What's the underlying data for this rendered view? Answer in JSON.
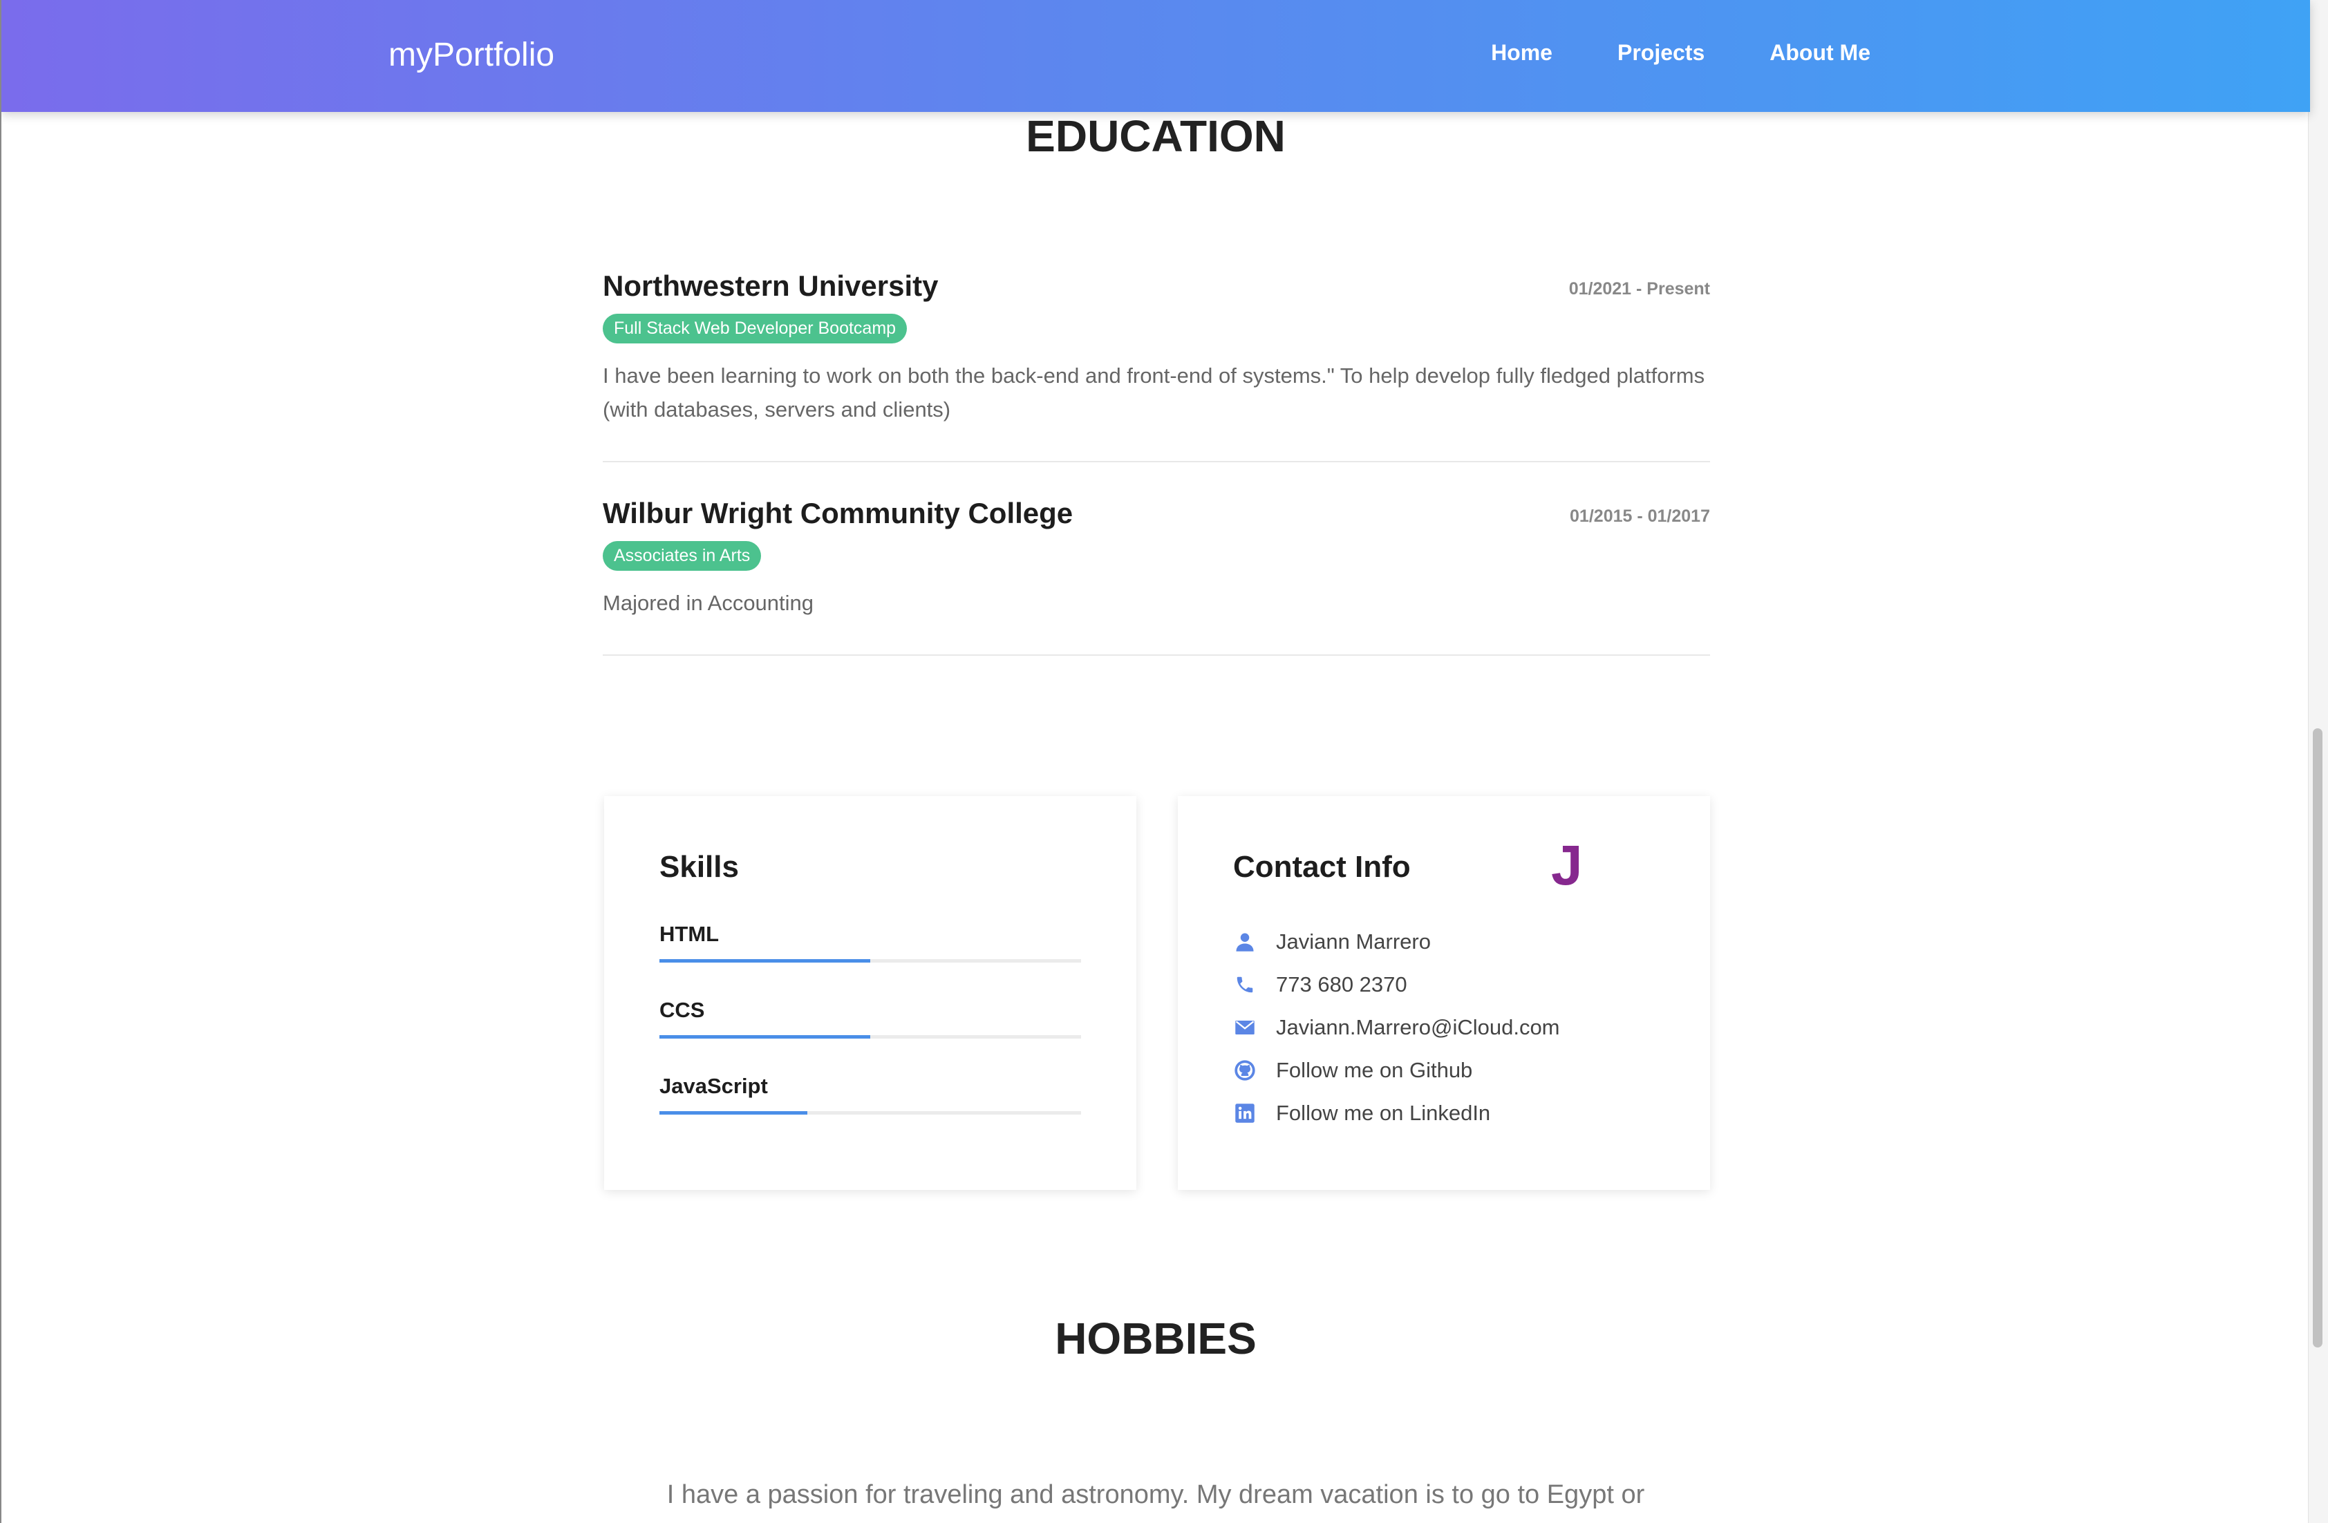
{
  "navbar": {
    "brand": "myPortfolio",
    "links": [
      "Home",
      "Projects",
      "About Me"
    ]
  },
  "education": {
    "title": "EDUCATION",
    "items": [
      {
        "school": "Northwestern University",
        "dates": "01/2021 - Present",
        "badge": "Full Stack Web Developer Bootcamp",
        "description": "I have been learning to work on both the back-end and front-end of systems.\" To help develop fully fledged platforms (with databases, servers and clients)"
      },
      {
        "school": "Wilbur Wright Community College",
        "dates": "01/2015 - 01/2017",
        "badge": "Associates in Arts",
        "description": "Majored in Accounting"
      }
    ]
  },
  "skills": {
    "title": "Skills",
    "items": [
      {
        "name": "HTML",
        "level": 0.5
      },
      {
        "name": "CCS",
        "level": 0.5
      },
      {
        "name": "JavaScript",
        "level": 0.35
      }
    ]
  },
  "contact": {
    "title": "Contact Info",
    "logo": "J",
    "items": [
      {
        "icon": "person-icon",
        "text": "Javiann Marrero"
      },
      {
        "icon": "phone-icon",
        "text": "773 680 2370"
      },
      {
        "icon": "mail-icon",
        "text": "Javiann.Marrero@iCloud.com"
      },
      {
        "icon": "github-icon",
        "text": "Follow me on Github"
      },
      {
        "icon": "linkedin-icon",
        "text": "Follow me on LinkedIn"
      }
    ]
  },
  "hobbies": {
    "title": "HOBBIES",
    "text": "I have a passion for traveling and astronomy. My dream vacation is to go to Egypt or"
  },
  "colors": {
    "accent": "#4a8ee8",
    "badge": "#4cc28e",
    "logo": "#86288e",
    "icon": "#5b86e5"
  }
}
